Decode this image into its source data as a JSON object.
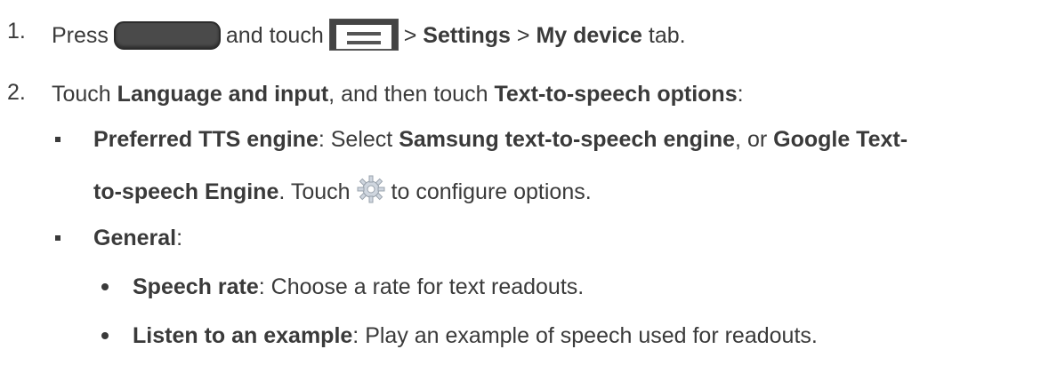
{
  "steps": [
    {
      "number": "1.",
      "press": "Press",
      "and_touch": "and touch",
      "sep1": ">",
      "settings": "Settings",
      "sep2": ">",
      "my_device": "My device",
      "tab": "tab."
    },
    {
      "number": "2.",
      "touch": "Touch",
      "language_input": "Language and input",
      "and_then": ", and then touch",
      "tts_options": "Text-to-speech options",
      "colon": ":"
    }
  ],
  "bullets": {
    "preferred": {
      "label": "Preferred TTS engine",
      "text1": ": Select",
      "samsung": "Samsung text-to-speech engine",
      "text2": ", or",
      "google1": "Google Text-",
      "google2": "to-speech Engine",
      "text3": ". Touch",
      "text4": "to configure options."
    },
    "general": {
      "label": "General",
      "colon": ":"
    },
    "speech_rate": {
      "label": "Speech rate",
      "text": ": Choose a rate for text readouts."
    },
    "listen": {
      "label": "Listen to an example",
      "text": ": Play an example of speech used for readouts."
    }
  },
  "icons": {
    "home_key": "home-key-icon",
    "menu": "menu-icon",
    "gear": "gear-icon"
  }
}
